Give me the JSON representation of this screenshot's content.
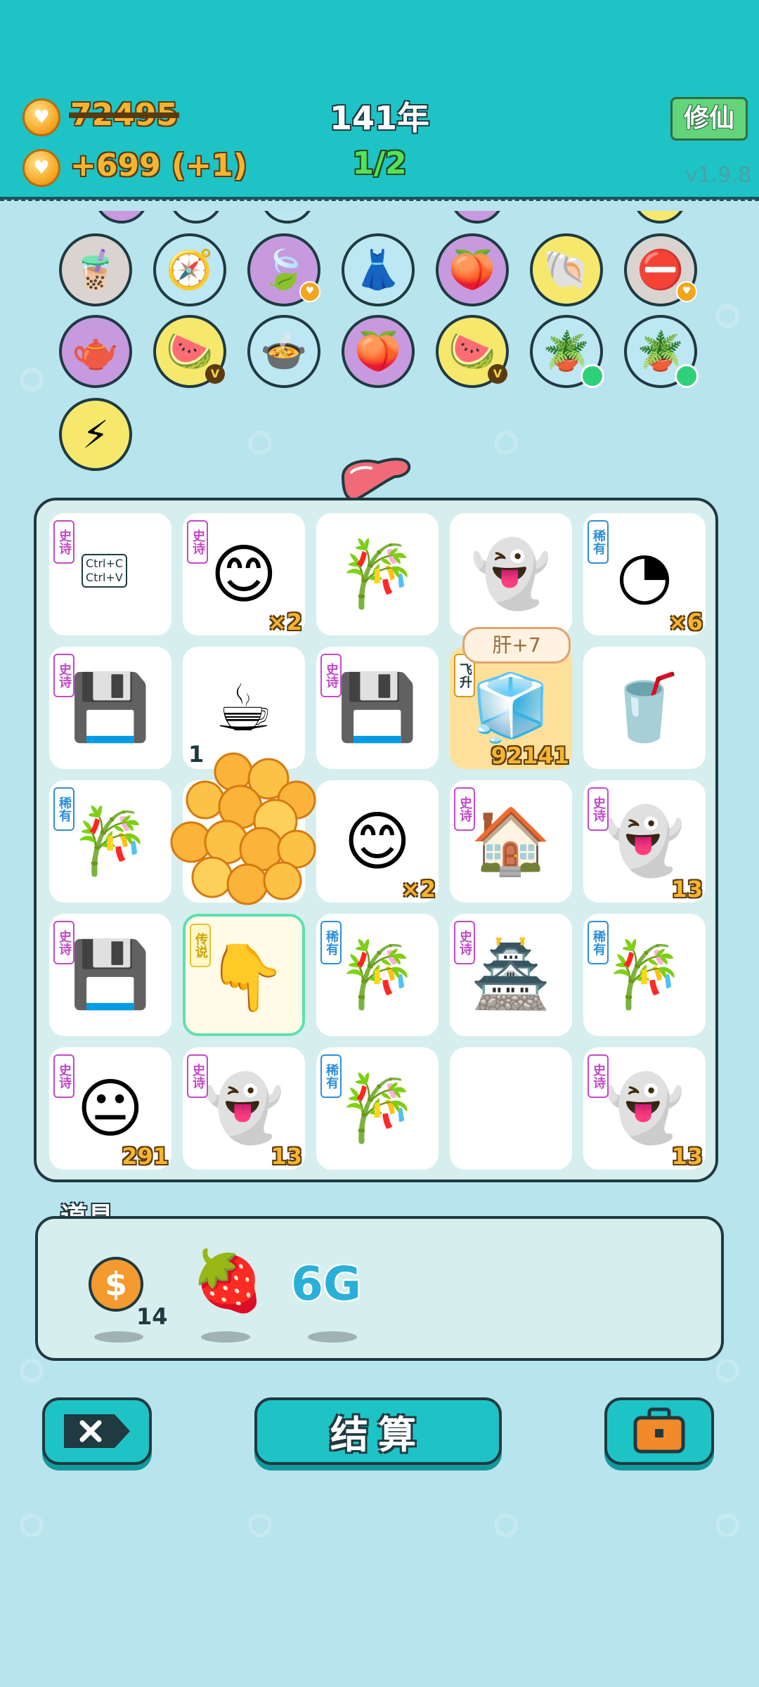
{
  "header": {
    "gold_total": "72495",
    "gold_income": "+699 (+1)",
    "year": "141年",
    "progress": "1/2",
    "mode_button": "修仙",
    "version": "v1.9.8",
    "coin_icon": "heart-coin-icon"
  },
  "relics": {
    "row1": [
      {
        "icon": "bubble-tea-jar",
        "color": "gray"
      },
      {
        "icon": "compass",
        "color": "blue"
      },
      {
        "icon": "leaf",
        "color": "purple",
        "badge": "heart"
      },
      {
        "icon": "pleated-skirt",
        "color": "blue"
      },
      {
        "icon": "eyepatch-fruit",
        "color": "purple"
      },
      {
        "icon": "seashell",
        "color": "yellow"
      },
      {
        "icon": "no-entry-sign",
        "color": "gray",
        "badge": "heart"
      }
    ],
    "row2": [
      {
        "icon": "gravy-boat",
        "color": "purple"
      },
      {
        "icon": "fruit-basket",
        "color": "yellow",
        "badge": "V"
      },
      {
        "icon": "duck-pot",
        "color": "blue"
      },
      {
        "icon": "eyepatch-fruit",
        "color": "purple"
      },
      {
        "icon": "fruit-basket",
        "color": "yellow",
        "badge": "V"
      },
      {
        "icon": "potted-flower",
        "color": "blue",
        "badge": "green"
      },
      {
        "icon": "potted-flower",
        "color": "blue",
        "badge": "green"
      }
    ],
    "row3": [
      {
        "icon": "lightning",
        "color": "yellow"
      }
    ]
  },
  "board": {
    "speech_bubble": "肝+7",
    "cells": [
      {
        "tag": "史诗",
        "tag_type": "epic",
        "icon": "copy-paste-cards",
        "caption_1": "Ctrl+C",
        "caption_2": "Ctrl+V",
        "count": ""
      },
      {
        "tag": "史诗",
        "tag_type": "epic",
        "icon": "smiling-face",
        "count": "×2"
      },
      {
        "tag": "",
        "icon": "bamboo",
        "count": ""
      },
      {
        "tag": "",
        "icon": "ghost",
        "count": ""
      },
      {
        "tag": "稀有",
        "tag_type": "rare",
        "icon": "gauge",
        "count": "×6"
      },
      {
        "tag": "史诗",
        "tag_type": "epic",
        "icon": "graphics-card",
        "count": ""
      },
      {
        "tag": "",
        "icon": "coffee-cup",
        "count": "1"
      },
      {
        "tag": "史诗",
        "tag_type": "epic",
        "icon": "graphics-card",
        "count": ""
      },
      {
        "tag": "飞升",
        "tag_type": "fly",
        "icon": "smiling-fridge",
        "count": "92141"
      },
      {
        "tag": "",
        "icon": "soda-cup",
        "count": ""
      },
      {
        "tag": "稀有",
        "tag_type": "rare",
        "icon": "bamboo",
        "count": ""
      },
      {
        "tag": "",
        "icon": "coin-burst",
        "count": ""
      },
      {
        "tag": "",
        "icon": "smiling-face",
        "count": "×2"
      },
      {
        "tag": "史诗",
        "tag_type": "epic",
        "icon": "rabbit-house",
        "count": ""
      },
      {
        "tag": "史诗",
        "tag_type": "epic",
        "icon": "ghost",
        "count": "13"
      },
      {
        "tag": "史诗",
        "tag_type": "epic",
        "icon": "graphics-card",
        "count": ""
      },
      {
        "tag": "传说",
        "tag_type": "legend",
        "icon": "pointing-finger",
        "count": ""
      },
      {
        "tag": "稀有",
        "tag_type": "rare",
        "icon": "bamboo",
        "count": ""
      },
      {
        "tag": "史诗",
        "tag_type": "epic",
        "icon": "crowned-rabbit-house",
        "count": ""
      },
      {
        "tag": "稀有",
        "tag_type": "rare",
        "icon": "bamboo",
        "count": ""
      },
      {
        "tag": "史诗",
        "tag_type": "epic",
        "icon": "neutral-face",
        "count": "291"
      },
      {
        "tag": "史诗",
        "tag_type": "epic",
        "icon": "ghost",
        "count": "13"
      },
      {
        "tag": "稀有",
        "tag_type": "rare",
        "icon": "bamboo",
        "count": ""
      },
      {
        "tag": "",
        "icon": "empty",
        "count": ""
      },
      {
        "tag": "史诗",
        "tag_type": "epic",
        "icon": "ghost",
        "count": "13"
      }
    ]
  },
  "props": {
    "title": "道具",
    "items": [
      {
        "icon": "dollar-coin",
        "count": "14"
      },
      {
        "icon": "strawberry",
        "count": ""
      },
      {
        "icon": "6g-logo",
        "label": "6G",
        "count": ""
      }
    ]
  },
  "buttons": {
    "close_icon": "close-tag-icon",
    "settle_label": "结算",
    "bag_icon": "briefcase-icon"
  }
}
